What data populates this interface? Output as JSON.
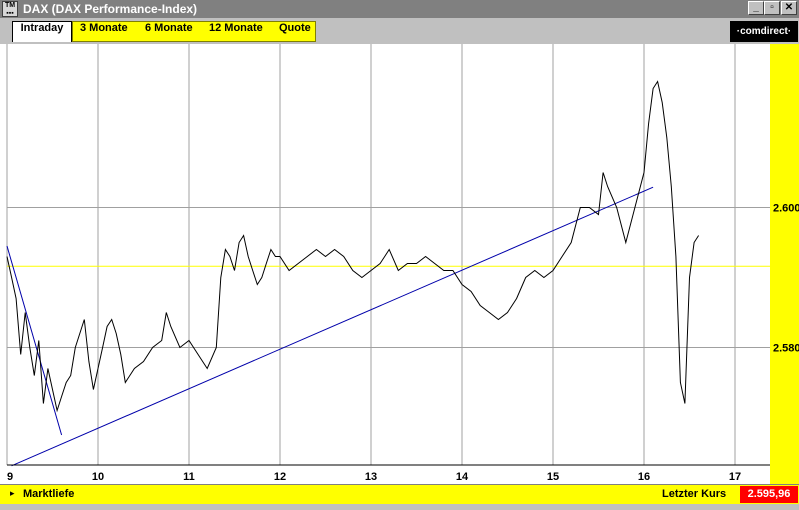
{
  "window": {
    "title": "DAX (DAX Performance-Index)",
    "icon_text_top": "TM",
    "icon_text_bottom": "▪▪▪",
    "min_glyph": "_",
    "max_glyph": "▫",
    "close_glyph": "✕"
  },
  "tabs": {
    "active": "Intraday",
    "items": [
      "3 Monate",
      "6 Monate",
      "12 Monate",
      "Quote"
    ]
  },
  "brand": {
    "logo_text": "·comdirect·"
  },
  "colors": {
    "background": "#c0c0c0",
    "chart_bg": "#ffffff",
    "accent_yellow": "#ffff00",
    "price_line": "#000000",
    "trend_line": "#0000aa",
    "reference_line": "#ffff00",
    "last_price_bg": "#ff0000"
  },
  "status": {
    "market_depth": "Marktliefe",
    "last_label": "Letzter Kurs",
    "last_value": "2.595,96",
    "arrow_glyph": "▸"
  },
  "chart_data": {
    "type": "line",
    "title": "",
    "xlabel": "",
    "ylabel": "",
    "x_ticks": [
      "9",
      "10",
      "11",
      "12",
      "13",
      "14",
      "15",
      "16",
      "17"
    ],
    "y_ticks": [
      "2.580",
      "2.600"
    ],
    "xlim": [
      9,
      17.3
    ],
    "ylim": [
      2562.5,
      2619.5
    ],
    "grid": true,
    "reference_line_y": 2591.6,
    "series": [
      {
        "x": [
          9.0,
          9.05,
          9.1,
          9.15,
          9.2,
          9.25,
          9.3,
          9.35,
          9.4,
          9.45,
          9.5,
          9.55,
          9.6,
          9.65,
          9.7,
          9.75,
          9.8,
          9.85,
          9.9,
          9.95,
          10.0,
          10.05,
          10.1,
          10.15,
          10.2,
          10.25,
          10.3,
          10.4,
          10.5,
          10.6,
          10.7,
          10.75,
          10.8,
          10.9,
          11.0,
          11.1,
          11.2,
          11.3,
          11.35,
          11.4,
          11.45,
          11.5,
          11.55,
          11.6,
          11.65,
          11.7,
          11.75,
          11.8,
          11.85,
          11.9,
          11.95,
          12.0,
          12.1,
          12.2,
          12.3,
          12.4,
          12.5,
          12.6,
          12.7,
          12.8,
          12.9,
          13.0,
          13.1,
          13.15,
          13.2,
          13.3,
          13.4,
          13.5,
          13.6,
          13.7,
          13.8,
          13.9,
          14.0,
          14.1,
          14.2,
          14.3,
          14.4,
          14.5,
          14.6,
          14.7,
          14.8,
          14.9,
          15.0,
          15.1,
          15.2,
          15.3,
          15.4,
          15.5,
          15.55,
          15.6,
          15.7,
          15.8,
          15.9,
          16.0,
          16.05,
          16.1,
          16.15,
          16.2,
          16.25,
          16.3,
          16.35,
          16.4,
          16.45,
          16.5,
          16.55,
          16.6
        ],
        "values": [
          2593,
          2590,
          2587,
          2579,
          2585,
          2580,
          2576,
          2581,
          2572,
          2577,
          2574,
          2571,
          2573,
          2575,
          2576,
          2580,
          2582,
          2584,
          2578,
          2574,
          2577,
          2580,
          2583,
          2584,
          2582,
          2579,
          2575,
          2577,
          2578,
          2580,
          2581,
          2585,
          2583,
          2580,
          2581,
          2579,
          2577,
          2580,
          2590,
          2594,
          2593,
          2591,
          2595,
          2596,
          2593,
          2591,
          2589,
          2590,
          2592,
          2594,
          2593,
          2593,
          2591,
          2592,
          2593,
          2594,
          2593,
          2594,
          2593,
          2591,
          2590,
          2591,
          2592,
          2593,
          2594,
          2591,
          2592,
          2592,
          2593,
          2592,
          2591,
          2591,
          2589,
          2588,
          2586,
          2585,
          2584,
          2585,
          2587,
          2590,
          2591,
          2590,
          2591,
          2593,
          2595,
          2600,
          2600,
          2599,
          2605,
          2603,
          2600,
          2595,
          2600,
          2605,
          2612,
          2617,
          2618,
          2615,
          2610,
          2603,
          2593,
          2575,
          2572,
          2590,
          2595,
          2596
        ]
      }
    ],
    "trend_lines": [
      {
        "x": [
          9.05,
          16.1
        ],
        "values": [
          2563.1,
          2602.9
        ]
      },
      {
        "x": [
          9.0,
          9.6
        ],
        "values": [
          2594.5,
          2567.5
        ]
      }
    ]
  }
}
